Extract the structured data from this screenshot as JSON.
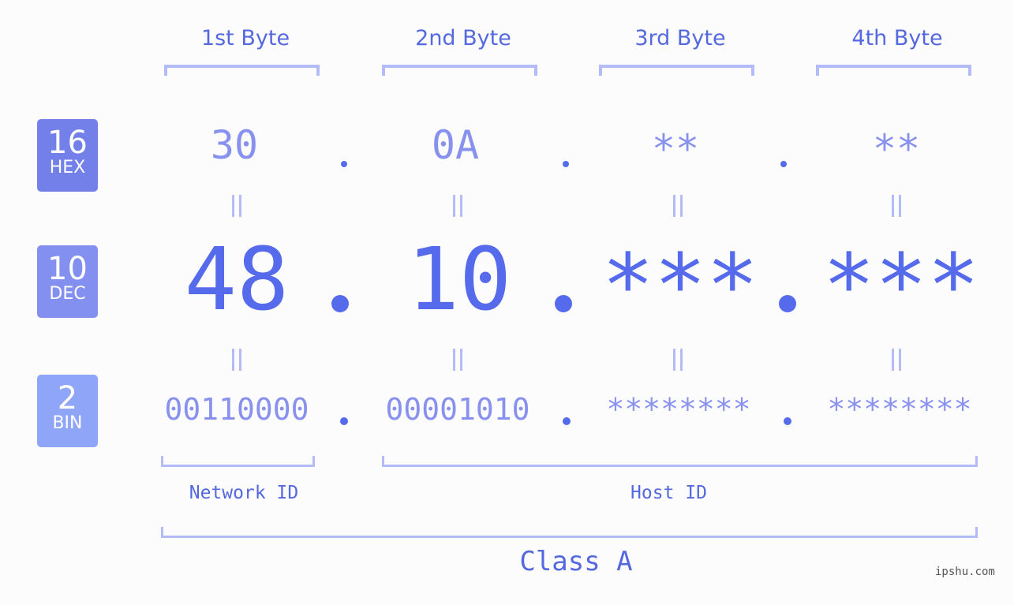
{
  "bytes": [
    {
      "header": "1st Byte",
      "hex": "30",
      "dec": "48",
      "bin": "00110000"
    },
    {
      "header": "2nd Byte",
      "hex": "0A",
      "dec": "10",
      "bin": "00001010"
    },
    {
      "header": "3rd Byte",
      "hex": "**",
      "dec": "***",
      "bin": "********"
    },
    {
      "header": "4th Byte",
      "hex": "**",
      "dec": "***",
      "bin": "********"
    }
  ],
  "badges": {
    "hex": {
      "num": "16",
      "label": "HEX",
      "color": "#7380ea"
    },
    "dec": {
      "num": "10",
      "label": "DEC",
      "color": "#8390f0"
    },
    "bin": {
      "num": "2",
      "label": "BIN",
      "color": "#8fa6f8"
    }
  },
  "labels": {
    "network_id": "Network ID",
    "host_id": "Host ID",
    "class": "Class A"
  },
  "watermark": "ipshu.com",
  "colors": {
    "accent": "#566bec",
    "light": "#8891ee",
    "bracket": "#b3bcf6"
  }
}
